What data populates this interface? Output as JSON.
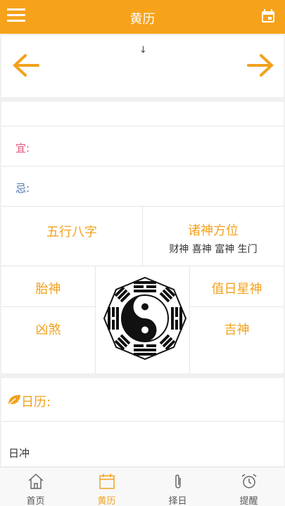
{
  "header": {
    "title": "黄历"
  },
  "nav": {
    "down_glyph": "↓"
  },
  "yi_label": "宜:",
  "ji_label": "忌:",
  "grid": {
    "wuxing": "五行八字",
    "zhushen": "诸神方位",
    "zhushen_sub": "财神 喜神 富神 生门",
    "taishen": "胎神",
    "zhiri": "值日星神",
    "xiongsha": "凶煞",
    "jishen": "吉神"
  },
  "calendar": {
    "title": "日历:",
    "richong": "日冲"
  },
  "tabs": [
    {
      "label": "首页",
      "icon": "home-icon"
    },
    {
      "label": "黄历",
      "icon": "calendar-icon"
    },
    {
      "label": "择日",
      "icon": "paperclip-icon"
    },
    {
      "label": "提醒",
      "icon": "alarm-clock-icon"
    }
  ],
  "colors": {
    "accent": "#f7a21b",
    "yi": "#e8557b",
    "ji": "#4b6fb0"
  }
}
